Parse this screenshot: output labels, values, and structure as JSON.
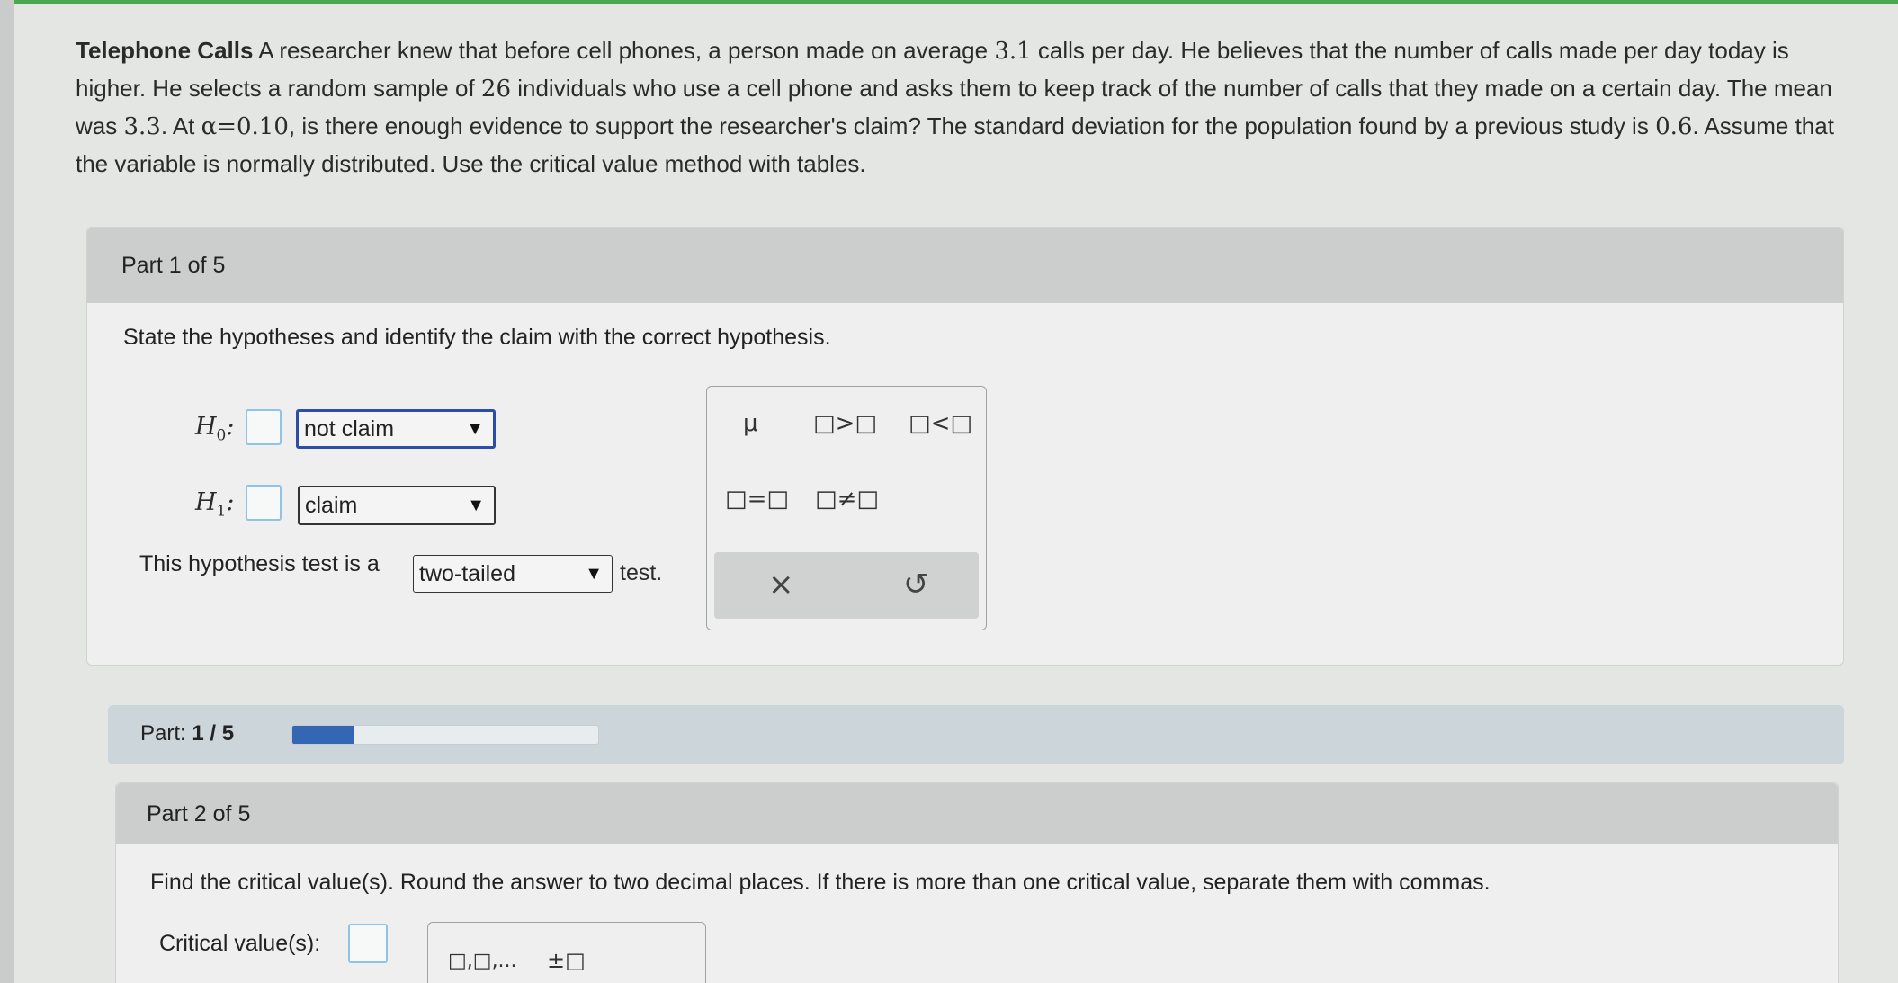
{
  "problem": {
    "title": "Telephone Calls",
    "text_1": " A researcher knew that before cell phones, a person made on average ",
    "value_1": "3.1",
    "text_2": " calls per day. He believes that the number of calls made per day today is higher. He selects a random sample of ",
    "value_2": "26",
    "text_3": " individuals who use a cell phone and asks them to keep track of the number of calls that they made on a certain day. The mean was ",
    "value_3": "3.3",
    "text_4": ". At ",
    "alpha": "α=0.10",
    "text_5": ", is there enough evidence to support the researcher's claim? The standard deviation for the population found by a previous study is ",
    "value_4": "0.6",
    "text_6": ". Assume that the variable is normally distributed. Use the critical value method with tables."
  },
  "part1": {
    "header": "Part 1 of 5",
    "prompt": "State the hypotheses and identify the claim with the correct hypothesis.",
    "h0_label": "H",
    "h0_sub": "0",
    "h1_label": "H",
    "h1_sub": "1",
    "colon": ":",
    "h0_select": "not claim",
    "h1_select": "claim",
    "test_prefix": "This hypothesis test is a",
    "test_select": "two-tailed",
    "test_suffix": "test.",
    "dropdown_arrow": "▼"
  },
  "palette": {
    "mu": "μ",
    "greater": "□>□",
    "less": "□<□",
    "equal": "□=□",
    "not_equal": "□≠□",
    "clear": "×",
    "undo": "↺"
  },
  "progress": {
    "label": "Part:",
    "value": "1 / 5",
    "fraction": 0.2,
    "fill_color": "#3566b3"
  },
  "part2": {
    "header": "Part 2 of 5",
    "prompt": "Find the critical value(s). Round the answer to two decimal places. If there is more than one critical value, separate them with commas.",
    "cv_label": "Critical value(s):",
    "palette_list": "□,□,...",
    "palette_pm": "±□"
  }
}
